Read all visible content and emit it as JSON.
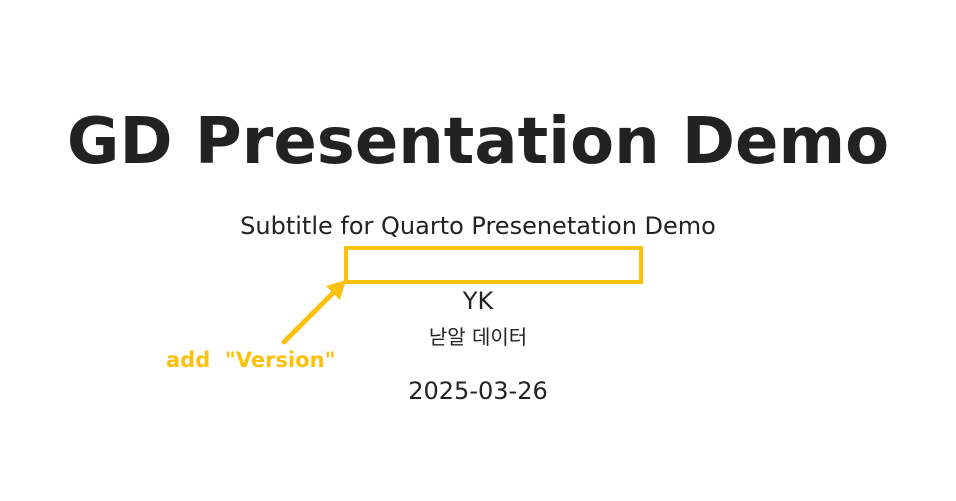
{
  "slide": {
    "title": "GD Presentation Demo",
    "subtitle": "Subtitle for Quarto Presenetation Demo",
    "author": "YK",
    "affiliation": "낟알 데이터",
    "date": "2025-03-26"
  },
  "annotation": {
    "label": "add  \"Version\"",
    "color": "#FCC10E",
    "arrow_icon": "arrow-up-right-icon"
  }
}
